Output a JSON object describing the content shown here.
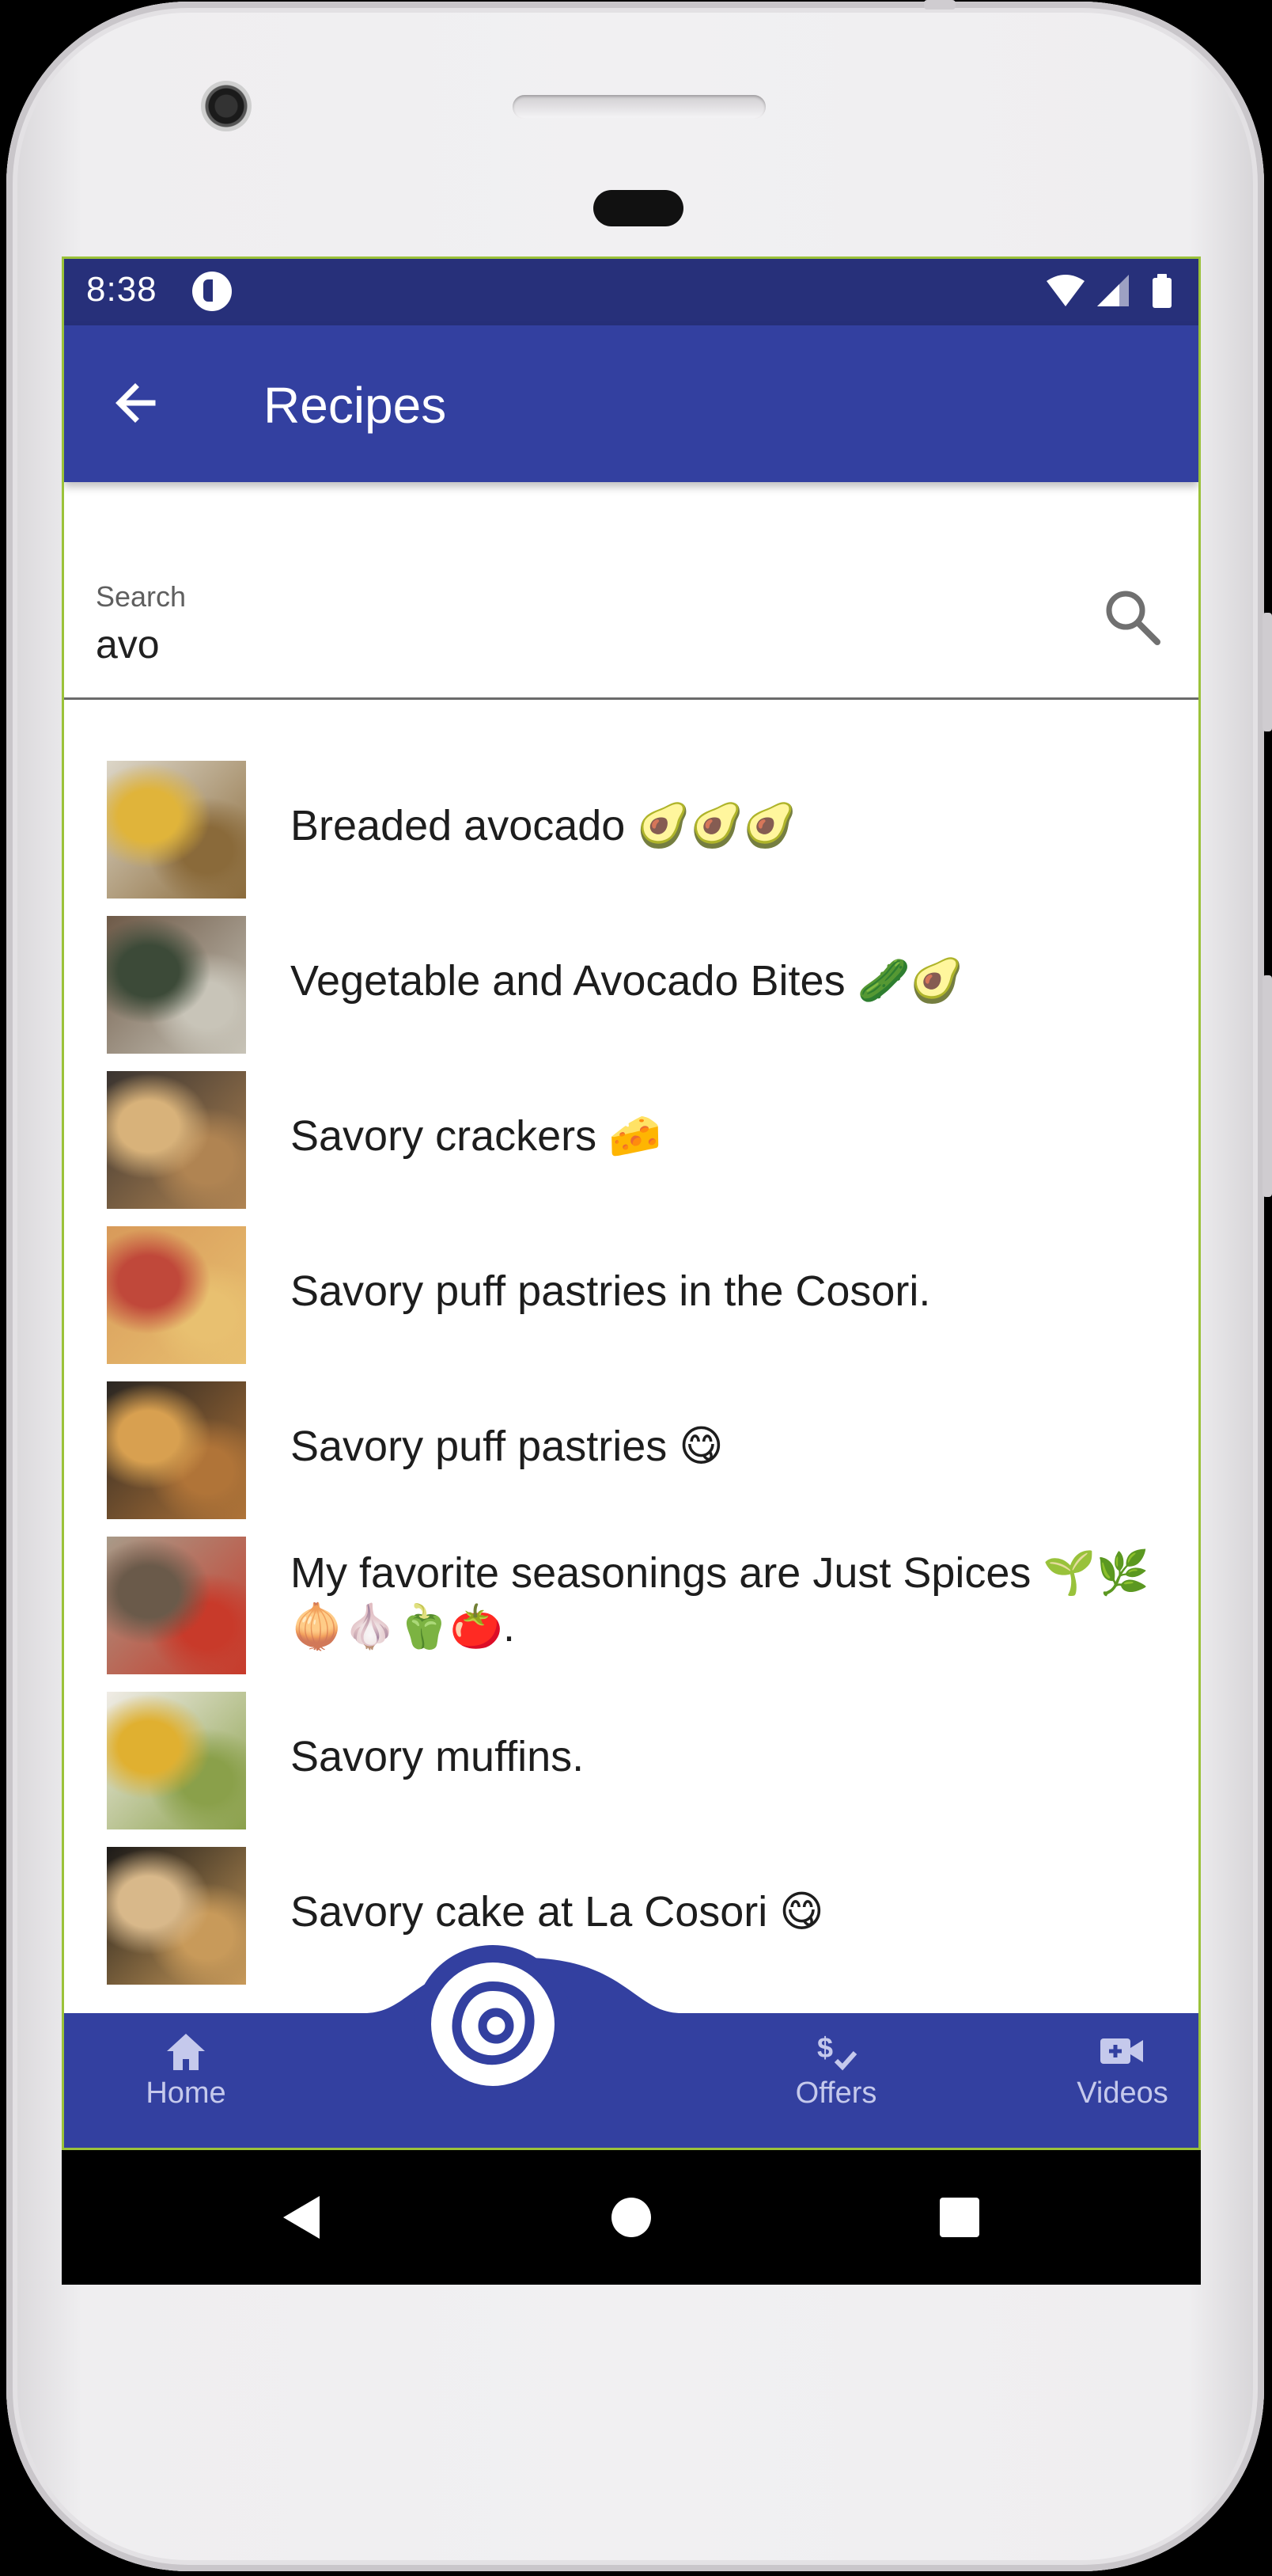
{
  "status_bar": {
    "time": "8:38"
  },
  "app_bar": {
    "title": "Recipes"
  },
  "search": {
    "label": "Search",
    "value": "avo"
  },
  "recipes": [
    {
      "title": "Breaded avocado 🥑🥑🥑",
      "thumb_colors": [
        "#dcd6c8",
        "#e0b43a",
        "#8a6a3a"
      ]
    },
    {
      "title": "Vegetable and Avocado Bites 🥒🥑",
      "thumb_colors": [
        "#6e5a48",
        "#3c4a38",
        "#c8c4b8"
      ]
    },
    {
      "title": "Savory crackers 🧀",
      "thumb_colors": [
        "#3a3430",
        "#d8b27a",
        "#b08452"
      ]
    },
    {
      "title": "Savory puff pastries in the Cosori.",
      "thumb_colors": [
        "#d89a5a",
        "#c0483a",
        "#e8c070"
      ]
    },
    {
      "title": "Savory puff pastries 😋",
      "thumb_colors": [
        "#2a2622",
        "#d8a050",
        "#b07438"
      ]
    },
    {
      "title": "My favorite seasonings are Just Spices 🌱🌿🧅🧄🫑🍅.",
      "thumb_colors": [
        "#a89a88",
        "#6a5a4a",
        "#c83a2a"
      ]
    },
    {
      "title": "Savory muffins.",
      "thumb_colors": [
        "#f0ece6",
        "#e0b030",
        "#8aa04a"
      ]
    },
    {
      "title": "Savory cake at La Cosori 😋",
      "thumb_colors": [
        "#1c1a18",
        "#d8b88a",
        "#c89a5a"
      ]
    }
  ],
  "bottom_nav": {
    "home": "Home",
    "offers": "Offers",
    "videos": "Videos"
  },
  "colors": {
    "primary": "#3340a0",
    "status_bar": "#27307a",
    "nav_inactive": "#c5c9ec"
  }
}
